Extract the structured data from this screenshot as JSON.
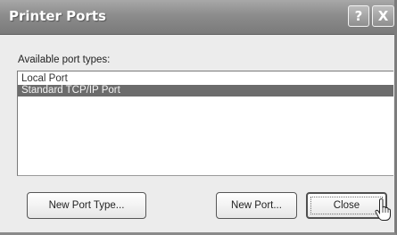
{
  "window": {
    "title": "Printer Ports",
    "help_label": "?",
    "close_label": "X"
  },
  "port_types": {
    "label": "Available port types:",
    "items": [
      {
        "label": "Local Port",
        "selected": false
      },
      {
        "label": "Standard TCP/IP Port",
        "selected": true
      }
    ]
  },
  "buttons": {
    "new_port_type": "New Port Type...",
    "new_port": "New Port...",
    "close": "Close"
  },
  "colors": {
    "selection": "#6c6c6c",
    "titlebar": "#8c8c8c"
  },
  "icons": {
    "cursor": "hand-pointer-icon"
  }
}
